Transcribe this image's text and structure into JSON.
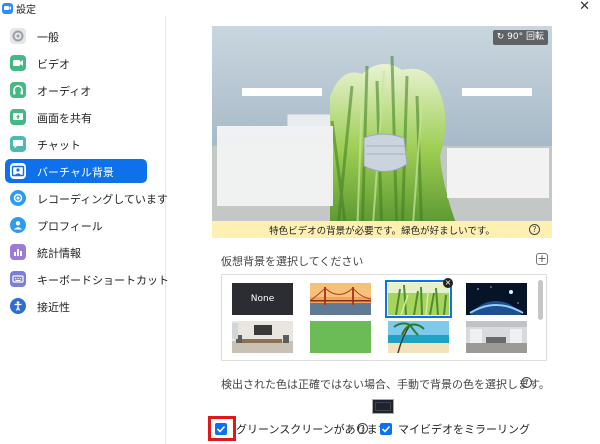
{
  "window": {
    "title": "設定",
    "close_glyph": "✕"
  },
  "sidebar": {
    "items": [
      {
        "label": "一般",
        "icon": "gear-icon",
        "color": "#d7d9dc",
        "active": false
      },
      {
        "label": "ビデオ",
        "icon": "video-icon",
        "color": "#46b883",
        "active": false
      },
      {
        "label": "オーディオ",
        "icon": "headphones-icon",
        "color": "#46b883",
        "active": false
      },
      {
        "label": "画面を共有",
        "icon": "share-screen-icon",
        "color": "#46b883",
        "active": false
      },
      {
        "label": "チャット",
        "icon": "chat-icon",
        "color": "#4fb8b0",
        "active": false
      },
      {
        "label": "バーチャル背景",
        "icon": "virtual-background-icon",
        "color": "#0e71eb",
        "active": true
      },
      {
        "label": "レコーディングしています",
        "icon": "record-icon",
        "color": "#2d9cf0",
        "active": false
      },
      {
        "label": "プロフィール",
        "icon": "profile-icon",
        "color": "#2d9cf0",
        "active": false
      },
      {
        "label": "統計情報",
        "icon": "statistics-icon",
        "color": "#9b7bd6",
        "active": false
      },
      {
        "label": "キーボードショートカット",
        "icon": "keyboard-icon",
        "color": "#7b7fd6",
        "active": false
      },
      {
        "label": "接近性",
        "icon": "accessibility-icon",
        "color": "#2d6fd6",
        "active": false
      }
    ]
  },
  "preview": {
    "rotate_label": "↻ 90° 回転",
    "warning": "特色ビデオの背景が必要です。緑色が好ましいです。",
    "help_glyph": "?"
  },
  "backgrounds": {
    "section_label": "仮想背景を選択してください",
    "add_glyph": "+",
    "items": [
      {
        "label": "None",
        "kind": "none",
        "selected": false
      },
      {
        "label": "",
        "kind": "golden-gate-bridge",
        "selected": false
      },
      {
        "label": "",
        "kind": "grass",
        "selected": true
      },
      {
        "label": "",
        "kind": "earth-from-space",
        "selected": false
      },
      {
        "label": "",
        "kind": "office-room",
        "selected": false
      },
      {
        "label": "",
        "kind": "green-screen",
        "selected": false
      },
      {
        "label": "",
        "kind": "beach",
        "selected": false
      },
      {
        "label": "",
        "kind": "office-hall",
        "selected": false
      }
    ],
    "remove_glyph": "×"
  },
  "detect": {
    "text": "検出された色は正確ではない場合、手動で背景の色を選択します。",
    "swatch_color": "#1f242c"
  },
  "options": {
    "green_screen_label": "グリーンスクリーンがあります",
    "green_screen_checked": true,
    "mirror_label": "マイビデオをミラーリング",
    "mirror_checked": true
  },
  "colors": {
    "accent": "#0e71eb",
    "warning_bg": "#fdf0b2",
    "highlight": "#e01818"
  }
}
